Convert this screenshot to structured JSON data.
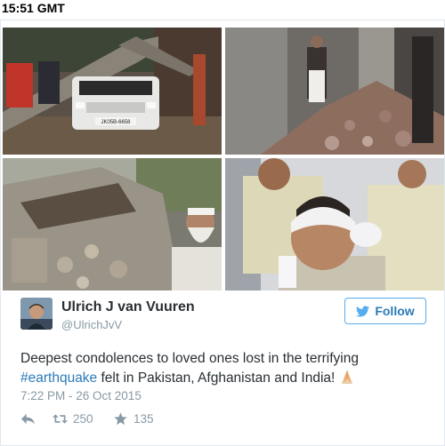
{
  "header": {
    "timestamp": "15:51 GMT"
  },
  "tweet": {
    "author": {
      "display_name": "Ulrich J van Vuuren",
      "handle": "@UlrichJvV"
    },
    "follow_label": "Follow",
    "text_before": "Deepest condolences to loved ones lost in the terrifying ",
    "hashtag": "#earthquake",
    "text_after": " felt in Pakistan, Afghanistan and India! ",
    "time": "7:22 PM - 26 Oct 2015",
    "actions": {
      "retweets": "250",
      "likes": "135"
    },
    "photos": [
      {
        "icon": "photo-car-under-fallen-tree",
        "plate_text": "JK05B-6658"
      },
      {
        "icon": "photo-rubble-alley"
      },
      {
        "icon": "photo-collapsed-house-elderly-man"
      },
      {
        "icon": "photo-injured-man-bandaged-head"
      }
    ],
    "colors": {
      "link": "#2b7bb9",
      "follow_border": "#55acee",
      "muted": "#8899a6",
      "text": "#292f33"
    }
  }
}
